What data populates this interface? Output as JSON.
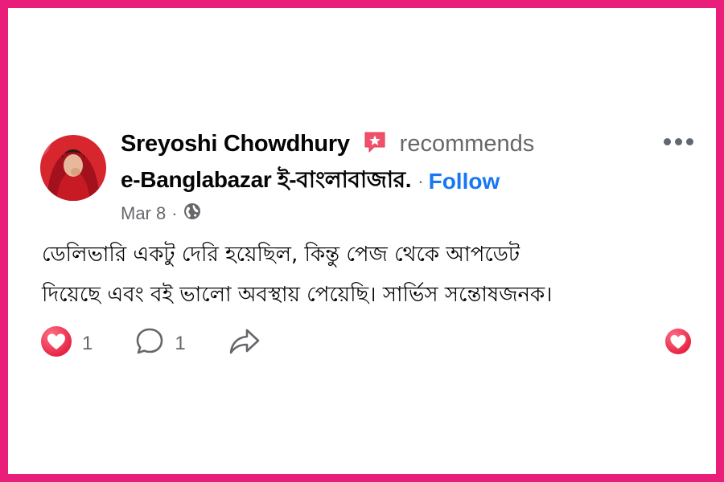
{
  "post": {
    "author": "Sreyoshi Chowdhury",
    "action": "recommends",
    "page": "e-Banglabazar ই-বাংলাবাজার.",
    "separator": "·",
    "follow": "Follow",
    "date": "Mar 8",
    "date_dot": "·",
    "body_lines": [
      "ডেলিভারি একটু দেরি হয়েছিল, কিন্তু পেজ থেকে আপডেট",
      "দিয়েছে এবং বই ভালো অবস্থায় পেয়েছি। সার্ভিস সন্তোষজনক।"
    ]
  },
  "actions": {
    "love_count": "1",
    "comment_count": "1"
  },
  "icons": {
    "recommend": "recommend-badge-icon",
    "privacy": "globe-icon",
    "more": "more-options-icon",
    "love": "love-reaction-icon",
    "comment": "comment-icon",
    "share": "share-icon"
  },
  "colors": {
    "frame": "#e91e7a",
    "link": "#1877f2",
    "love": "#f33e58",
    "muted": "#65676b"
  }
}
